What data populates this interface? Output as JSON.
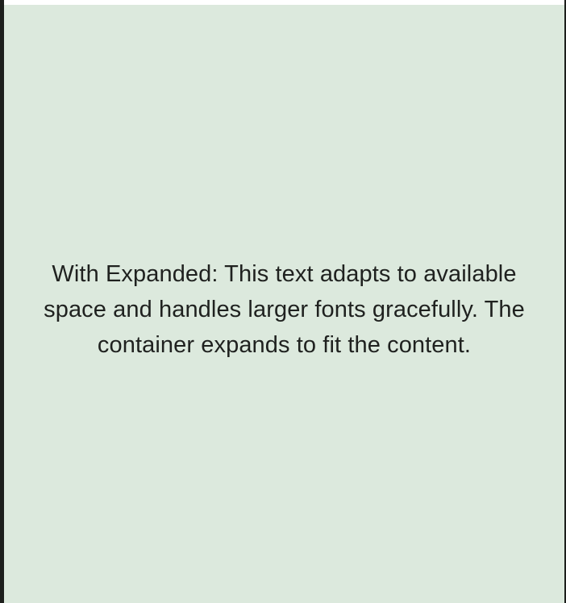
{
  "panel": {
    "message": "With Expanded: This text adapts to available space and handles larger fonts gracefully. The container expands to fit the content."
  },
  "colors": {
    "panel_background": "#dce9dd",
    "text": "#1f211f",
    "frame": "#1d1f1c",
    "top_strip": "#ffffff"
  }
}
